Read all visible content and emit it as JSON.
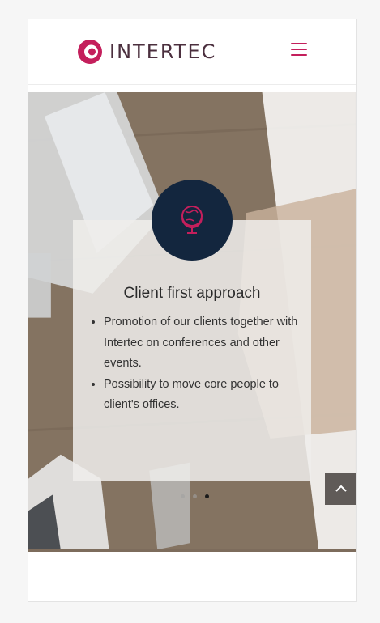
{
  "header": {
    "brand": "INTERTEC",
    "menu_icon": "hamburger-menu-icon"
  },
  "slide": {
    "icon": "globe-icon",
    "title": "Client first approach",
    "bullets": [
      "Promotion of our clients together with Intertec on conferences and other events.",
      "Possibility to move core people to client's offices."
    ],
    "slide_count": 3,
    "active_slide": 3
  },
  "scroll_top": {
    "icon": "chevron-up-icon"
  },
  "colors": {
    "accent": "#c41f5c",
    "brand_text": "#4b2f3e",
    "badge_bg": "#13263e"
  }
}
